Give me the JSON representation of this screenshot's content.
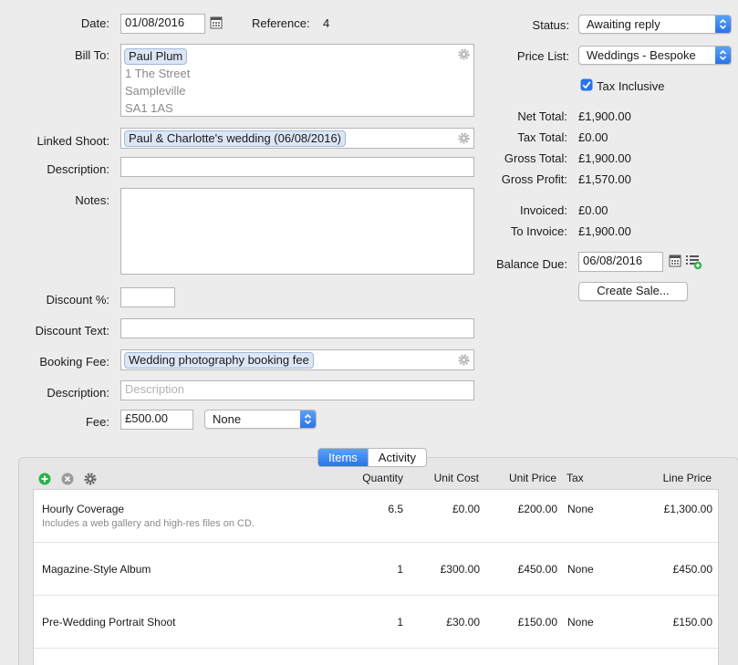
{
  "form": {
    "date_label": "Date:",
    "date_value": "01/08/2016",
    "reference_label": "Reference:",
    "reference_value": "4",
    "bill_to_label": "Bill To:",
    "bill_to_contact": "Paul Plum",
    "bill_to_address": [
      "1 The Street",
      "Sampleville",
      "SA1 1AS"
    ],
    "linked_shoot_label": "Linked Shoot:",
    "linked_shoot_value": "Paul & Charlotte's wedding (06/08/2016)",
    "description_label": "Description:",
    "description_value": "",
    "notes_label": "Notes:",
    "notes_value": "",
    "discount_pct_label": "Discount %:",
    "discount_pct_value": "",
    "discount_text_label": "Discount Text:",
    "discount_text_value": "",
    "booking_fee_label": "Booking Fee:",
    "booking_fee_value": "Wedding photography booking fee",
    "fee_description_label": "Description:",
    "fee_description_placeholder": "Description",
    "fee_label": "Fee:",
    "fee_value": "£500.00",
    "fee_tax_value": "None"
  },
  "summary": {
    "status_label": "Status:",
    "status_value": "Awaiting reply",
    "price_list_label": "Price List:",
    "price_list_value": "Weddings - Bespoke",
    "tax_inclusive_label": "Tax Inclusive",
    "tax_inclusive_checked": true,
    "net_total_label": "Net Total:",
    "net_total_value": "£1,900.00",
    "tax_total_label": "Tax Total:",
    "tax_total_value": "£0.00",
    "gross_total_label": "Gross Total:",
    "gross_total_value": "£1,900.00",
    "gross_profit_label": "Gross Profit:",
    "gross_profit_value": "£1,570.00",
    "invoiced_label": "Invoiced:",
    "invoiced_value": "£0.00",
    "to_invoice_label": "To Invoice:",
    "to_invoice_value": "£1,900.00",
    "balance_due_label": "Balance Due:",
    "balance_due_value": "06/08/2016",
    "create_sale_label": "Create Sale..."
  },
  "tabs": {
    "items_label": "Items",
    "activity_label": "Activity"
  },
  "table": {
    "headers": {
      "quantity": "Quantity",
      "unit_cost": "Unit Cost",
      "unit_price": "Unit Price",
      "tax": "Tax",
      "line_price": "Line Price"
    },
    "rows": [
      {
        "name": "Hourly Coverage",
        "detail": "Includes a web gallery and high-res files on CD.",
        "quantity": "6.5",
        "unit_cost": "£0.00",
        "unit_price": "£200.00",
        "tax": "None",
        "line_price": "£1,300.00"
      },
      {
        "name": "Magazine-Style Album",
        "detail": "",
        "quantity": "1",
        "unit_cost": "£300.00",
        "unit_price": "£450.00",
        "tax": "None",
        "line_price": "£450.00"
      },
      {
        "name": "Pre-Wedding Portrait Shoot",
        "detail": "",
        "quantity": "1",
        "unit_cost": "£30.00",
        "unit_price": "£150.00",
        "tax": "None",
        "line_price": "£150.00"
      }
    ]
  },
  "colors": {
    "accent": "#2a73ea",
    "token_bg": "#dce6f5",
    "add_green": "#2ab24a",
    "remove_gray": "#9a9a9a"
  },
  "icons": [
    "calendar-icon",
    "gear-icon",
    "add-icon",
    "remove-icon",
    "list-add-icon",
    "checkbox-checked-icon",
    "popup-arrows-icon"
  ]
}
